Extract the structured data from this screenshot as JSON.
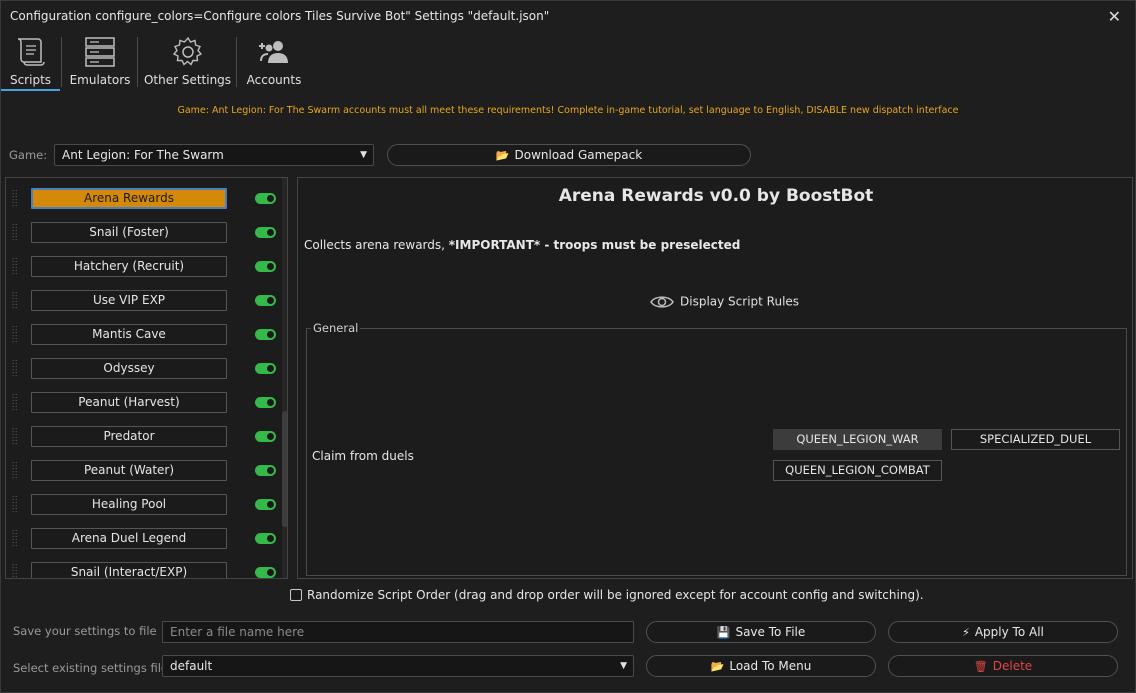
{
  "window": {
    "title": "Configuration configure_colors=Configure colors Tiles Survive Bot\" Settings \"default.json\"",
    "close_glyph": "✕"
  },
  "toolbar": {
    "tabs": [
      {
        "label": "Scripts",
        "icon": "scroll-icon",
        "active": true
      },
      {
        "label": "Emulators",
        "icon": "server-icon",
        "active": false
      },
      {
        "label": "Other Settings",
        "icon": "gear-icon",
        "active": false
      },
      {
        "label": "Accounts",
        "icon": "users-add-icon",
        "active": false
      }
    ]
  },
  "notice": "Game: Ant Legion: For The Swarm accounts must all meet these requirements! Complete in-game tutorial, set language to English, DISABLE new dispatch interface",
  "game": {
    "label": "Game:",
    "selected": "Ant Legion: For The Swarm",
    "download_label": "Download Gamepack"
  },
  "scripts": [
    {
      "name": "Arena Rewards",
      "enabled": true,
      "selected": true
    },
    {
      "name": "Snail (Foster)",
      "enabled": true,
      "selected": false
    },
    {
      "name": "Hatchery (Recruit)",
      "enabled": true,
      "selected": false
    },
    {
      "name": "Use VIP EXP",
      "enabled": true,
      "selected": false
    },
    {
      "name": "Mantis Cave",
      "enabled": true,
      "selected": false
    },
    {
      "name": "Odyssey",
      "enabled": true,
      "selected": false
    },
    {
      "name": "Peanut (Harvest)",
      "enabled": true,
      "selected": false
    },
    {
      "name": "Predator",
      "enabled": true,
      "selected": false
    },
    {
      "name": "Peanut (Water)",
      "enabled": true,
      "selected": false
    },
    {
      "name": "Healing Pool",
      "enabled": true,
      "selected": false
    },
    {
      "name": "Arena Duel Legend",
      "enabled": true,
      "selected": false
    },
    {
      "name": "Snail (Interact/EXP)",
      "enabled": true,
      "selected": false
    }
  ],
  "detail": {
    "title": "Arena Rewards v0.0 by BoostBot",
    "desc_prefix": "Collects arena rewards, ",
    "desc_bold": "*IMPORTANT* - troops must be preselected",
    "rules_label": "Display Script Rules",
    "group_title": "General",
    "option_label": "Claim from duels",
    "option_values": [
      {
        "label": "QUEEN_LEGION_WAR",
        "active": true
      },
      {
        "label": "SPECIALIZED_DUEL",
        "active": false
      },
      {
        "label": "QUEEN_LEGION_COMBAT",
        "active": false
      }
    ]
  },
  "randomize_label": "Randomize Script Order (drag and drop order will be ignored except for account config and switching).",
  "bottom": {
    "save_label": "Save your settings to file",
    "file_placeholder": "Enter a file name here",
    "select_label": "Select existing settings file",
    "selected_file": "default",
    "save_button": "Save To File",
    "apply_button": "Apply To All",
    "load_button": "Load To Menu",
    "delete_button": "Delete"
  },
  "colors": {
    "selected_script": "#d48a08",
    "toggle_on": "#35b94a",
    "notice": "#e8a51e",
    "delete": "#e04545"
  }
}
